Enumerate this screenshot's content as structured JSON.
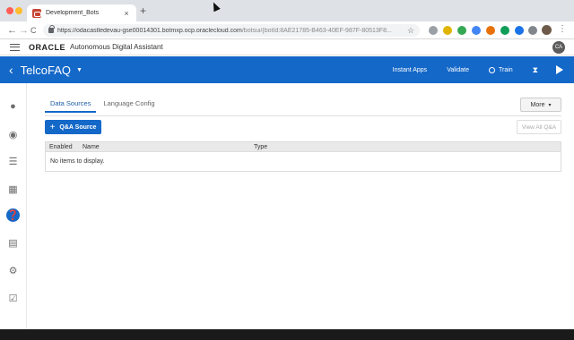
{
  "browser": {
    "tab_title": "Development_Bots",
    "tab_close": "×",
    "new_tab": "+",
    "url_main": "https://odacastledevau-gse00014301.botmxp.ocp.oraclecloud.com",
    "url_path": "/botsui/{botId:8AE21785-B463-40EF-987F-80513F8...",
    "back": "←",
    "forward": "→",
    "reload": "C",
    "star": "☆",
    "menu": "⋮"
  },
  "app_header": {
    "logo": "ORACLE",
    "product": "Autonomous Digital Assistant",
    "user_initials": "CA"
  },
  "bot_bar": {
    "back": "‹",
    "bot_name": "TelcoFAQ",
    "caret": "▼",
    "actions": {
      "instant_apps": "Instant Apps",
      "validate": "Validate",
      "train": "Train"
    }
  },
  "main": {
    "tabs": [
      "Data Sources",
      "Language Config"
    ],
    "more_label": "More",
    "more_caret": "▾",
    "qa_source_label": "Q&A Source",
    "qa_plus": "+",
    "view_all_label": "View All Q&A",
    "table": {
      "columns": [
        "Enabled",
        "Name",
        "Type"
      ],
      "empty_text": "No items to display."
    }
  },
  "colors": {
    "brand_blue": "#1468c8",
    "oracle_red": "#c74634"
  }
}
